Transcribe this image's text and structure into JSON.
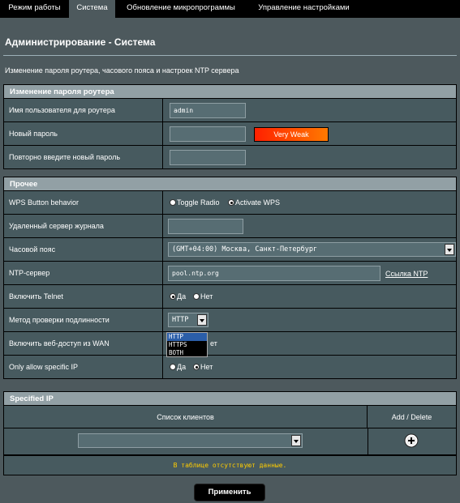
{
  "tabs": [
    {
      "label": "Режим работы"
    },
    {
      "label": "Система"
    },
    {
      "label": "Обновление микропрограммы"
    },
    {
      "label": "Управление настройками"
    }
  ],
  "page": {
    "title": "Администрирование - Система",
    "subtitle": "Изменение пароля роутера, часового пояса и настроек NTP сервера"
  },
  "password_section": {
    "title": "Изменение пароля роутера",
    "username_label": "Имя пользователя для роутера",
    "username_value": "admin",
    "new_password_label": "Новый пароль",
    "new_password_value": "",
    "strength": "Very Weak",
    "confirm_label": "Повторно введите новый пароль",
    "confirm_value": ""
  },
  "misc_section": {
    "title": "Прочее",
    "wps_label": "WPS Button behavior",
    "wps_opt1": "Toggle Radio",
    "wps_opt2": "Activate WPS",
    "syslog_label": "Удаленный сервер журнала",
    "syslog_value": "",
    "timezone_label": "Часовой пояс",
    "timezone_value": "(GMT+04:00) Москва, Санкт-Петербург",
    "ntp_label": "NTP-сервер",
    "ntp_value": "pool.ntp.org",
    "ntp_link": "Ссылка NTP",
    "telnet_label": "Включить Telnet",
    "yes": "Да",
    "no": "Нет",
    "auth_label": "Метод проверки подлинности",
    "auth_value": "HTTP",
    "auth_options": [
      "HTTP",
      "HTTPS",
      "BOTH"
    ],
    "wan_label": "Включить веб-доступ из WAN",
    "wan_no_partial": "ет",
    "specific_ip_label": "Only allow specific IP"
  },
  "specified_ip": {
    "title": "Specified IP",
    "col_clients": "Список клиентов",
    "col_add_delete": "Add / Delete",
    "empty_text": "В таблице отсутствуют данные."
  },
  "apply_label": "Применить",
  "colors": {
    "background": "#4d595d",
    "tabbar": "#000000",
    "section_header": "#92a0a5",
    "strength_weak": "#ff4400",
    "empty_text": "#ffcc00"
  }
}
